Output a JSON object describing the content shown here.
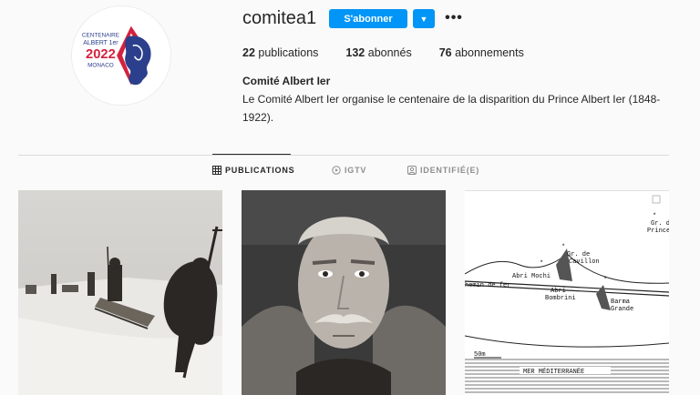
{
  "profile": {
    "username": "comitea1",
    "follow_label": "S'abonner",
    "full_name": "Comité Albert Ier",
    "bio": "Le Comité Albert Ier organise le centenaire de la disparition du Prince Albert Ier (1848-1922)."
  },
  "logo": {
    "line1": "CENTENAIRE",
    "line2": "ALBERT 1er",
    "year": "2022",
    "place": "MONACO"
  },
  "stats": [
    {
      "count": "22",
      "label": "publications"
    },
    {
      "count": "132",
      "label": "abonnés"
    },
    {
      "count": "76",
      "label": "abonnements"
    }
  ],
  "tabs": [
    {
      "label": "PUBLICATIONS",
      "active": true
    },
    {
      "label": "IGTV",
      "active": false
    },
    {
      "label": "IDENTIFIÉ(E)",
      "active": false
    }
  ],
  "map_labels": {
    "gr_cavillon": "Gr. de",
    "cavillon": "Cavillon",
    "abri_mochi": "Abri Mochi",
    "chemin": "hemin de fer",
    "abri_bombrini": "Abri",
    "bombrini": "Bombrini",
    "barma": "Barma",
    "grande": "Grande",
    "gr_du_prince": "Gr. de",
    "prince": "Prince",
    "mer": "MER MÉDITERRANÉE",
    "scale": "50m"
  },
  "colors": {
    "accent": "#0095f6",
    "logo_red": "#d4213d",
    "logo_blue": "#2b3f8c"
  }
}
